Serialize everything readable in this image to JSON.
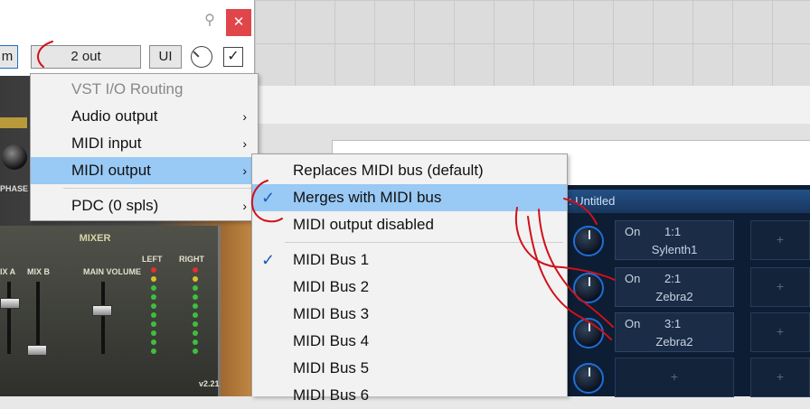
{
  "plugin_window": {
    "toolbar": {
      "io_label": "m",
      "output_label": "2 out",
      "ui_label": "UI"
    },
    "close_glyph": "✕",
    "pin_glyph": "⚲"
  },
  "context_menu": {
    "items": [
      {
        "label": "VST I/O Routing",
        "disabled": true
      },
      {
        "label": "Audio output",
        "arrow": "›"
      },
      {
        "label": "MIDI input",
        "arrow": "›"
      },
      {
        "label": "MIDI output",
        "arrow": "›",
        "highlighted": true
      },
      {
        "label": "PDC (0 spls)",
        "arrow": "›"
      }
    ]
  },
  "midi_output_submenu": {
    "items": [
      {
        "label": "Replaces MIDI bus (default)",
        "checked": false
      },
      {
        "label": "Merges with MIDI bus",
        "checked": true,
        "highlighted": true
      },
      {
        "label": "MIDI output disabled",
        "checked": false
      }
    ],
    "buses": [
      {
        "label": "MIDI Bus 1",
        "checked": true
      },
      {
        "label": "MIDI Bus 2"
      },
      {
        "label": "MIDI Bus 3"
      },
      {
        "label": "MIDI Bus 4"
      },
      {
        "label": "MIDI Bus 5"
      },
      {
        "label": "MIDI Bus 6"
      }
    ],
    "check_glyph": "✓"
  },
  "synth_panel": {
    "mixer_title": "MIXER",
    "labels": [
      "IX A",
      "MIX B",
      "MAIN VOLUME",
      "LEFT",
      "RIGHT"
    ],
    "phase_label": "PHASE",
    "version": "v2.21"
  },
  "blue_panel": {
    "title": ": Untitled",
    "slots": [
      {
        "on": "On",
        "channel": "1:1",
        "name": "Sylenth1"
      },
      {
        "on": "On",
        "channel": "2:1",
        "name": "Zebra2"
      },
      {
        "on": "On",
        "channel": "3:1",
        "name": "Zebra2"
      }
    ],
    "empty_plus": "+"
  },
  "colors": {
    "menu_highlight": "#99c9f5",
    "check_color": "#1d5fb8",
    "annotation_red": "#d0101a",
    "close_red": "#e0454a"
  }
}
